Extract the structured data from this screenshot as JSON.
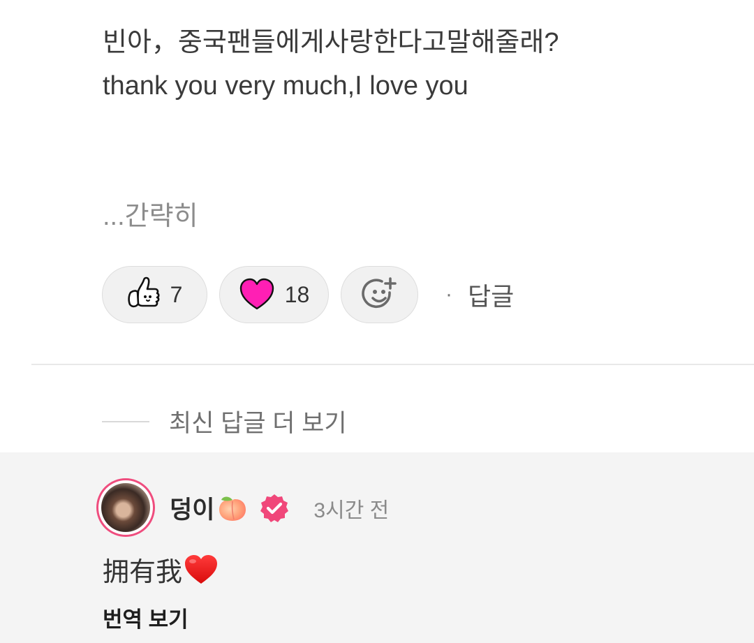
{
  "comment": {
    "lines": [
      "빈아，중국팬들에게사랑한다고말해줄래?",
      "thank you very much,I love you"
    ],
    "collapse_label": "...간략히"
  },
  "reactions": {
    "like": {
      "icon": "thumbs-up-icon",
      "count": "7"
    },
    "heart": {
      "icon": "heart-icon",
      "count": "18",
      "color": "#ff1fb4"
    },
    "add": {
      "icon": "add-emoji-icon"
    },
    "separator": "·",
    "reply_label": "답글"
  },
  "more_replies_label": "최신 답글 더 보기",
  "reply": {
    "username": "덩이",
    "username_emoji": "peach-icon",
    "verified_icon": "verified-badge-icon",
    "verified_color": "#f0477a",
    "time": "3시간 전",
    "text": "拥有我",
    "text_emoji": "red-heart-icon",
    "translate_label": "번역 보기",
    "section_background": "#f4f4f4",
    "avatar_ring_color": "#ef4d7e"
  }
}
